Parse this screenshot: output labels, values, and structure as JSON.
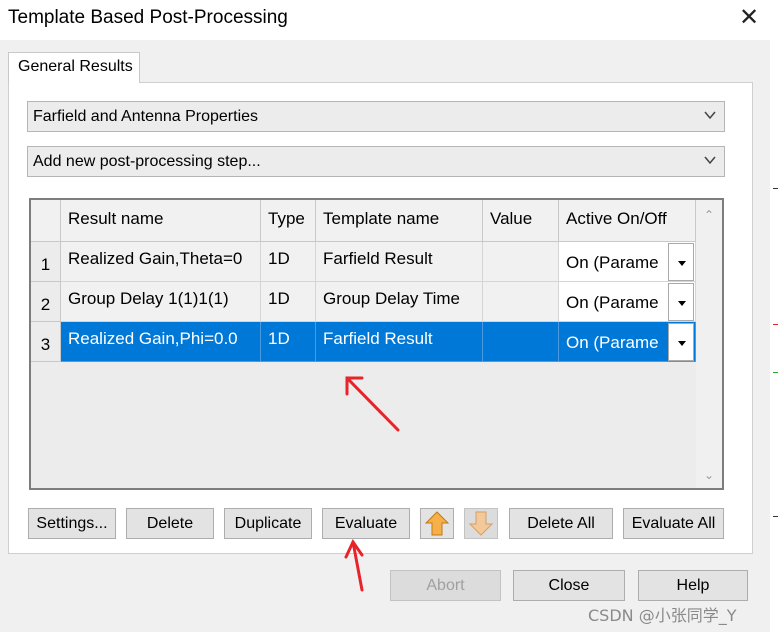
{
  "window": {
    "title": "Template Based Post-Processing",
    "close_glyph": "✕"
  },
  "tab": {
    "label": "General Results"
  },
  "combo_category": {
    "value": "Farfield and Antenna Properties"
  },
  "combo_step": {
    "value": "Add new post-processing step..."
  },
  "table": {
    "headers": [
      "Result name",
      "Type",
      "Template name",
      "Value",
      "Active On/Off"
    ],
    "rows": [
      {
        "num": "1",
        "result": "Realized Gain,Theta=0",
        "type": "1D",
        "template": "Farfield Result",
        "value": "",
        "active": "On (Parame",
        "selected": false
      },
      {
        "num": "2",
        "result": "Group Delay 1(1)1(1)",
        "type": "1D",
        "template": "Group Delay Time",
        "value": "",
        "active": "On (Parame",
        "selected": false
      },
      {
        "num": "3",
        "result": "Realized Gain,Phi=0.0",
        "type": "1D",
        "template": "Farfield Result",
        "value": "",
        "active": "On (Parame",
        "selected": true
      }
    ]
  },
  "buttons": {
    "settings": "Settings...",
    "delete": "Delete",
    "duplicate": "Duplicate",
    "evaluate": "Evaluate",
    "delete_all": "Delete All",
    "evaluate_all": "Evaluate All",
    "abort": "Abort",
    "close": "Close",
    "help": "Help"
  },
  "icons": {
    "move_up": "arrow-up-icon",
    "move_down": "arrow-down-icon"
  },
  "colors": {
    "selection": "#0078d7",
    "annotation": "#e8242a",
    "arrow_fill": "#f5b04a"
  },
  "watermark": "CSDN @小张同学_Y"
}
